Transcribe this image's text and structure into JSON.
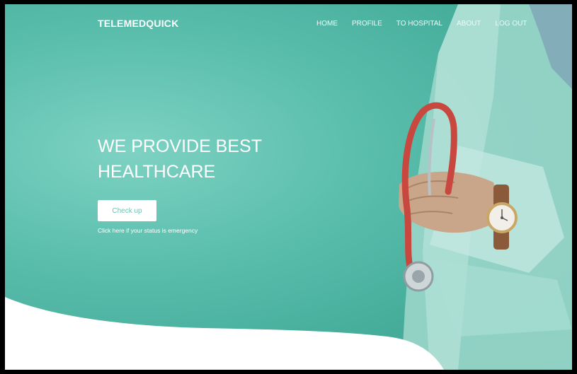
{
  "brand": {
    "name": "TELEMEDQUICK"
  },
  "nav": {
    "items": [
      {
        "label": "HOME"
      },
      {
        "label": "PROFILE"
      },
      {
        "label": "TO HOSPITAL"
      },
      {
        "label": "ABOUT"
      },
      {
        "label": "LOG OUT"
      }
    ]
  },
  "hero": {
    "headline_line1": "WE PROVIDE BEST",
    "headline_line2": "HEALTHCARE",
    "cta_label": "Check up",
    "cta_note": "Click here if your status is emergency"
  },
  "colors": {
    "teal": "#5cbfae",
    "teal_dark": "#3aa592",
    "button_text": "#6cc4b3",
    "white": "#ffffff"
  },
  "icons": {
    "photo": "doctor-with-stethoscope-image"
  }
}
